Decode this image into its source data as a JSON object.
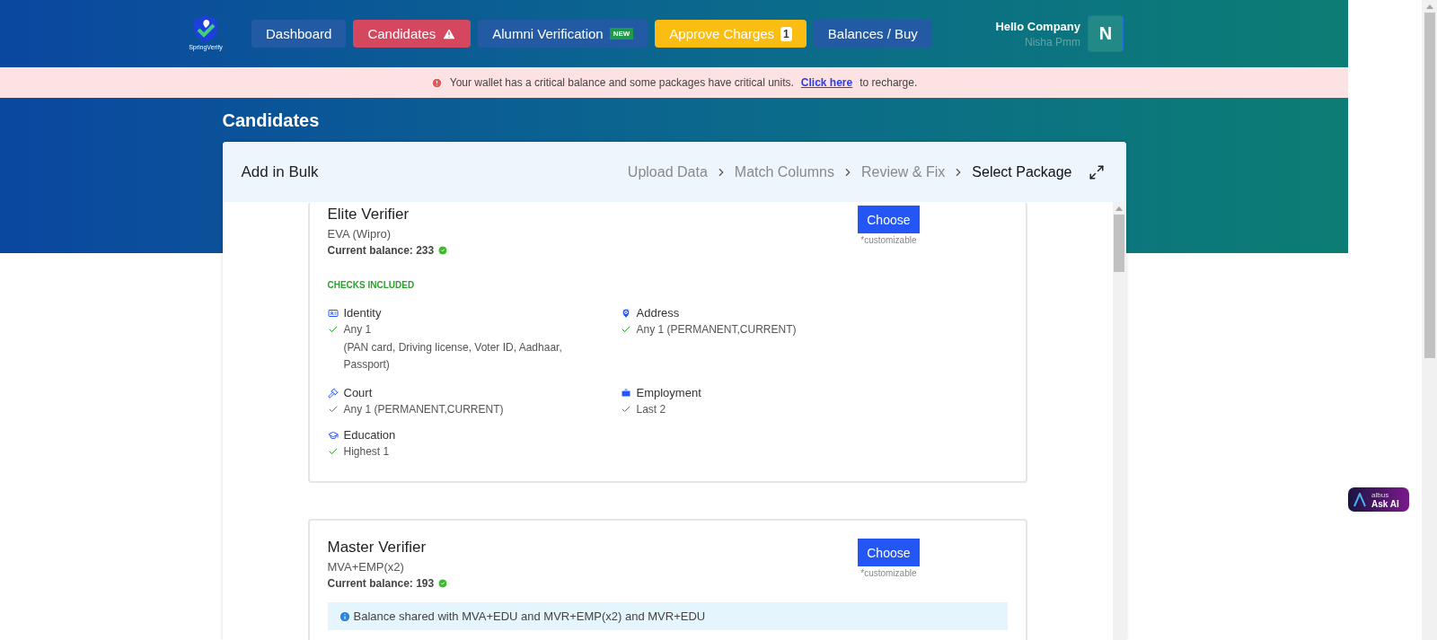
{
  "header": {
    "logo_text": "SpringVerify",
    "nav": [
      {
        "label": "Dashboard",
        "kind": "plain",
        "selected": false
      },
      {
        "label": "Candidates",
        "kind": "warning",
        "selected": true
      },
      {
        "label": "Alumni Verification",
        "kind": "new",
        "badge": "NEW",
        "selected": false
      },
      {
        "label": "Approve Charges",
        "kind": "count",
        "badge": "1",
        "selected": false
      },
      {
        "label": "Balances / Buy",
        "kind": "plain",
        "selected": false
      }
    ],
    "greeting": "Hello Company",
    "user_name": "Nisha Pmm",
    "avatar_letter": "N"
  },
  "alert": {
    "message": "Your wallet has a critical balance and some packages have critical units.",
    "link": "Click here",
    "suffix": "to recharge."
  },
  "page_title": "Candidates",
  "modal": {
    "title": "Add in Bulk",
    "steps": [
      {
        "label": "Upload Data",
        "selected": false
      },
      {
        "label": "Match Columns",
        "selected": false
      },
      {
        "label": "Review & Fix",
        "selected": false
      },
      {
        "label": "Select Package",
        "selected": true
      }
    ],
    "packages": [
      {
        "name": "Elite Verifier",
        "code": "EVA (Wipro)",
        "balance": "Current balance: 233",
        "button": "Choose",
        "note": "*customizable",
        "checks_title": "CHECKS INCLUDED",
        "checks": [
          {
            "kind": "identity",
            "label": "Identity",
            "lines": [
              "Any 1"
            ],
            "detail": "(PAN card, Driving license, Voter ID, Aadhaar, Passport)"
          },
          {
            "kind": "address",
            "label": "Address",
            "lines": [
              "Any 1 (PERMANENT,CURRENT)"
            ]
          },
          {
            "kind": "court",
            "label": "Court",
            "lines": [
              "Any 1 (PERMANENT,CURRENT)"
            ]
          },
          {
            "kind": "employment",
            "label": "Employment",
            "lines": [
              "Last 2"
            ]
          },
          {
            "kind": "education",
            "label": "Education",
            "lines": [
              "Highest 1"
            ]
          }
        ]
      },
      {
        "name": "Master Verifier",
        "code": "MVA+EMP(x2)",
        "balance": "Current balance: 193",
        "button": "Choose",
        "note": "*customizable",
        "info": "Balance shared with MVA+EDU and MVR+EMP(x2) and MVR+EDU"
      }
    ]
  },
  "assistant": {
    "brand": "albus",
    "label": "Ask AI"
  }
}
